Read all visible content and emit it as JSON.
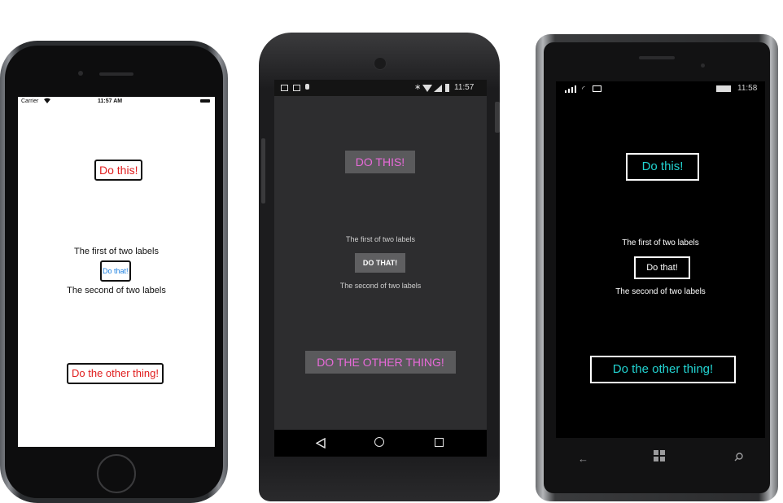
{
  "ios": {
    "status": {
      "carrier": "Carrier",
      "time": "11:57 AM"
    },
    "buttons": {
      "do_this": "Do this!",
      "do_that": "Do that!",
      "do_other": "Do the other thing!"
    },
    "labels": {
      "first": "The first of two labels",
      "second": "The second of two labels"
    }
  },
  "android": {
    "status": {
      "time": "11:57"
    },
    "buttons": {
      "do_this": "DO THIS!",
      "do_that": "DO THAT!",
      "do_other": "DO THE OTHER THING!"
    },
    "labels": {
      "first": "The first of two labels",
      "second": "The second of two labels"
    },
    "nav_icons": [
      "back-icon",
      "home-icon",
      "recents-icon"
    ]
  },
  "winphone": {
    "status": {
      "time": "11:58"
    },
    "buttons": {
      "do_this": "Do this!",
      "do_that": "Do that!",
      "do_other": "Do the other thing!"
    },
    "labels": {
      "first": "The first of two labels",
      "second": "The second of two labels"
    },
    "nav_icons": [
      "back-arrow-icon",
      "windows-logo-icon",
      "search-icon"
    ]
  },
  "colors": {
    "ios_button_text": "#e01d1d",
    "ios_do_that_text": "#1a7fe0",
    "android_accent": "#e86ad9",
    "android_button_bg": "#5a5a5c",
    "wp_accent": "#22d3d1"
  }
}
